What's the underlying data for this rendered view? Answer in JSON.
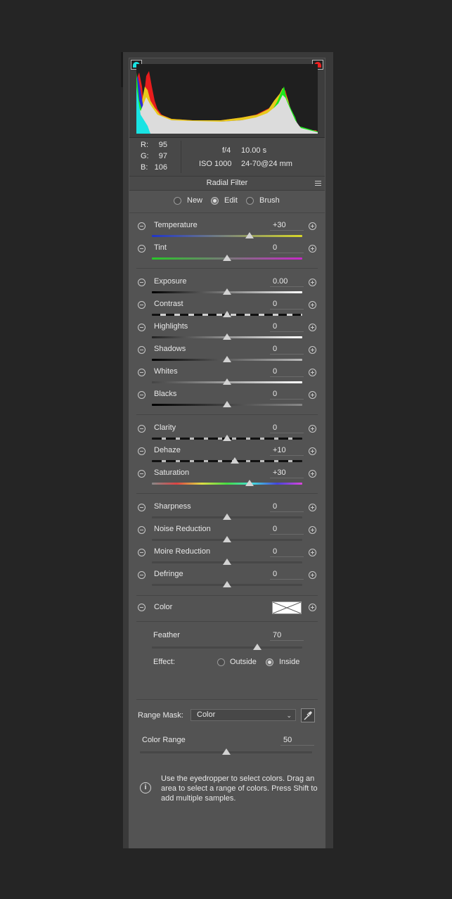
{
  "readout": {
    "r_label": "R:",
    "r": "95",
    "g_label": "G:",
    "g": "97",
    "b_label": "B:",
    "b": "106",
    "aperture": "f/4",
    "shutter": "10.00 s",
    "iso": "ISO 1000",
    "lens": "24-70@24 mm"
  },
  "panel_title": "Radial Filter",
  "modes": {
    "new": "New",
    "edit": "Edit",
    "brush": "Brush",
    "selected": "edit"
  },
  "sliders": [
    {
      "label": "Temperature",
      "value": "+30",
      "fraction": 0.65
    },
    {
      "label": "Tint",
      "value": "0",
      "fraction": 0.5
    },
    {
      "label": "Exposure",
      "value": "0.00",
      "fraction": 0.5
    },
    {
      "label": "Contrast",
      "value": "0",
      "fraction": 0.5
    },
    {
      "label": "Highlights",
      "value": "0",
      "fraction": 0.5
    },
    {
      "label": "Shadows",
      "value": "0",
      "fraction": 0.5
    },
    {
      "label": "Whites",
      "value": "0",
      "fraction": 0.5
    },
    {
      "label": "Blacks",
      "value": "0",
      "fraction": 0.5
    },
    {
      "label": "Clarity",
      "value": "0",
      "fraction": 0.5
    },
    {
      "label": "Dehaze",
      "value": "+10",
      "fraction": 0.55
    },
    {
      "label": "Saturation",
      "value": "+30",
      "fraction": 0.65
    },
    {
      "label": "Sharpness",
      "value": "0",
      "fraction": 0.5
    },
    {
      "label": "Noise Reduction",
      "value": "0",
      "fraction": 0.5
    },
    {
      "label": "Moire Reduction",
      "value": "0",
      "fraction": 0.5
    },
    {
      "label": "Defringe",
      "value": "0",
      "fraction": 0.5
    }
  ],
  "color_label": "Color",
  "feather": {
    "label": "Feather",
    "value": "70",
    "fraction": 0.7
  },
  "effect": {
    "label": "Effect:",
    "outside": "Outside",
    "inside": "Inside",
    "selected": "inside"
  },
  "range_mask": {
    "label": "Range Mask:",
    "value": "Color"
  },
  "color_range": {
    "label": "Color Range",
    "value": "50",
    "fraction": 0.5
  },
  "help_text": "Use the eyedropper to select colors. Drag an area to select a range of colors. Press Shift to add multiple samples.",
  "colors": {
    "panel": "#535353",
    "frame": "#3a3a3a",
    "background": "#252525"
  }
}
